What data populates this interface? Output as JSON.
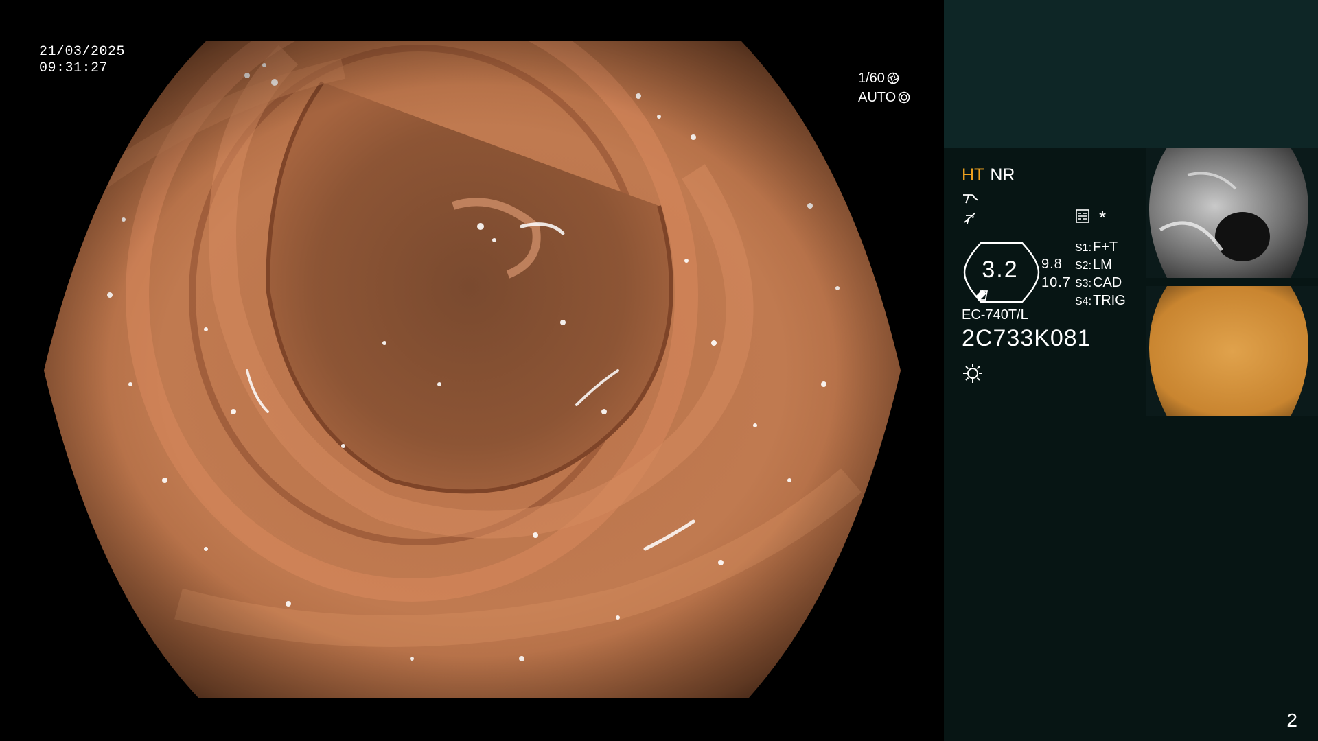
{
  "overlay": {
    "date": "21/03/2025",
    "time": "09:31:27",
    "shutter": "1/60",
    "iris_mode": "AUTO"
  },
  "panel": {
    "ht_label": "HT",
    "nr_label": "NR",
    "zoom_value": "3.2",
    "gauge_top": "9.8",
    "gauge_bottom": "10.7",
    "slots": [
      {
        "key": "S1:",
        "value": "F+T"
      },
      {
        "key": "S2:",
        "value": "LM"
      },
      {
        "key": "S3:",
        "value": "CAD"
      },
      {
        "key": "S4:",
        "value": "TRIG"
      }
    ],
    "model": "EC-740T/L",
    "serial": "2C733K081",
    "asterisk": "*"
  },
  "page_number": "2",
  "colors": {
    "ht_accent": "#f0a21f",
    "panel_bg": "#071514",
    "panel_top_bg": "#0e2626"
  },
  "icons": [
    "aperture-icon",
    "iris-icon",
    "sharpness-icon",
    "enhance-icon",
    "memory-icon",
    "light-icon"
  ]
}
